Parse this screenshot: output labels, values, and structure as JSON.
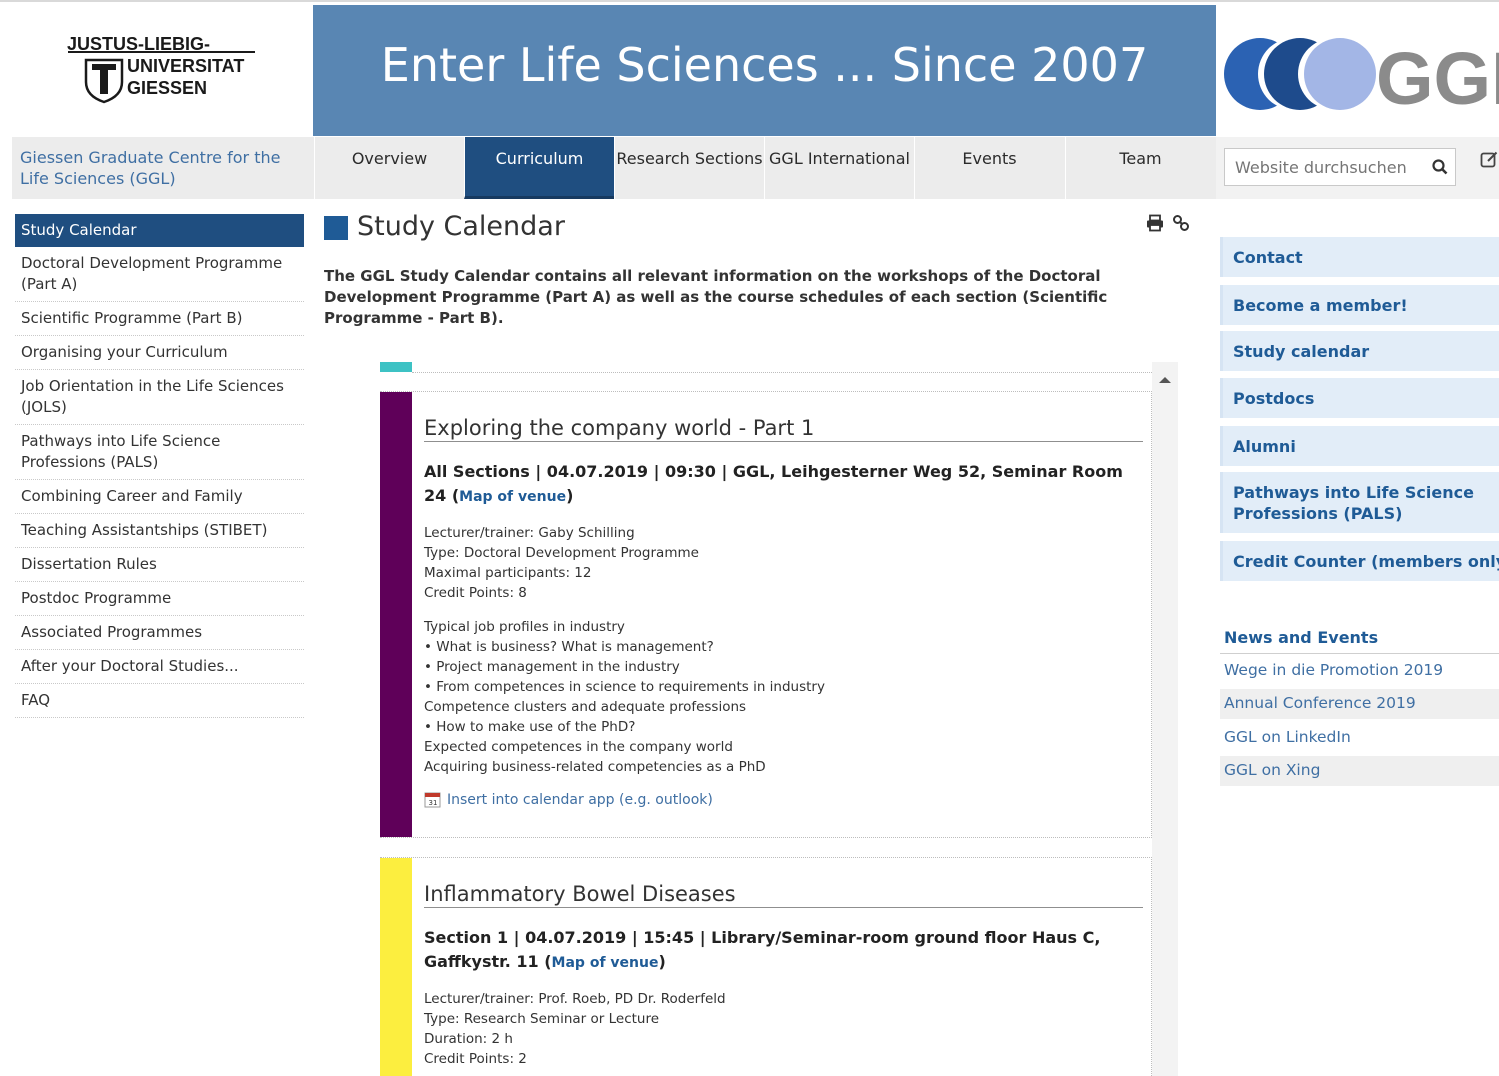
{
  "header": {
    "university_lines": [
      "JUSTUS-LIEBIG-",
      "UNIVERSITAT",
      "GIESSEN"
    ],
    "banner_title": "Enter Life Sciences ... Since 2007",
    "ggl_logo_text": "GGL",
    "banner_color": "#5986b3"
  },
  "nav": {
    "home": "Giessen Graduate Centre for the Life Sciences (GGL)",
    "items": [
      "Overview",
      "Curriculum",
      "Research Sections",
      "GGL International",
      "Events",
      "Team"
    ],
    "active": "Curriculum",
    "search_placeholder": "Website durchsuchen"
  },
  "leftnav": {
    "items": [
      "Study Calendar",
      "Doctoral Development Programme (Part A)",
      "Scientific Programme (Part B)",
      "Organising your Curriculum",
      "Job Orientation in the Life Sciences (JOLS)",
      "Pathways into Life Science Professions (PALS)",
      "Combining Career and Family",
      "Teaching Assistantships (STIBET)",
      "Dissertation Rules",
      "Postdoc Programme",
      "Associated Programmes",
      "After your Doctoral Studies...",
      "FAQ"
    ],
    "active": "Study Calendar"
  },
  "main": {
    "title": "Study Calendar",
    "intro": "The GGL Study Calendar contains all relevant information on the workshops of the Doctoral Development Programme (Part A) as well as the course schedules of each section (Scientific Programme - Part B).",
    "events": [
      {
        "title": "Exploring the company world - Part 1",
        "meta": "All Sections | 04.07.2019 | 09:30 | GGL, Leihgesterner Weg 52, Seminar Room 24 (",
        "map_link": "Map of venue",
        "meta_end": ")",
        "details": [
          "Lecturer/trainer: Gaby Schilling",
          "Type: Doctoral Development Programme",
          "Maximal participants: 12",
          "Credit Points: 8"
        ],
        "description": [
          "Typical job profiles in industry",
          "• What is business? What is management?",
          "• Project management in the industry",
          "• From competences in science to requirements in industry",
          "Competence clusters and adequate professions",
          "• How to make use of the PhD?",
          "Expected competences in the company world",
          "Acquiring business-related competencies as a PhD"
        ],
        "calendar_link": "Insert into calendar app (e.g. outlook)",
        "color": "#5f0059"
      },
      {
        "title": "Inflammatory Bowel Diseases",
        "meta": "Section 1 | 04.07.2019 | 15:45 | Library/Seminar-room ground floor Haus C, Gaffkystr. 11 (",
        "map_link": "Map of venue",
        "meta_end": ")",
        "details": [
          "Lecturer/trainer: Prof. Roeb, PD Dr. Roderfeld",
          "Type: Research Seminar or Lecture",
          "Duration: 2 h",
          "Credit Points: 2"
        ],
        "color": "#fcee3f"
      }
    ],
    "top_strip_color": "#3dc2c4"
  },
  "sidebar": {
    "links": [
      "Contact",
      "Become a member!",
      "Study calendar",
      "Postdocs",
      "Alumni",
      "Pathways into Life Science Professions (PALS)",
      "Credit Counter (members only)"
    ],
    "news_heading": "News and Events",
    "news": [
      "Wege in die Promotion 2019",
      "Annual Conference 2019",
      "GGL on LinkedIn",
      "GGL on Xing"
    ]
  }
}
